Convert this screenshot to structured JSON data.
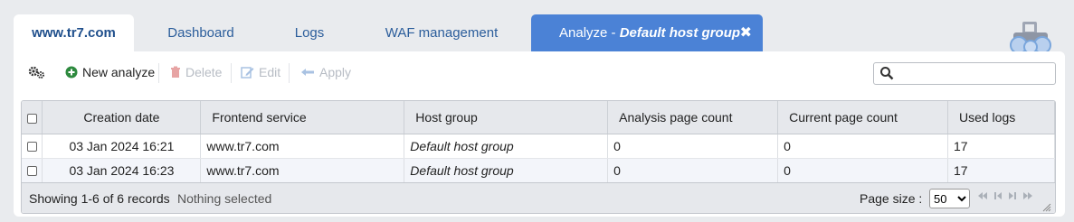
{
  "tabs": {
    "home": "www.tr7.com",
    "items": [
      "Dashboard",
      "Logs",
      "WAF management"
    ],
    "active_prefix": "Analyze - ",
    "active_em": "Default host group",
    "active_close": "✖"
  },
  "toolbar": {
    "new_analyze": "New analyze",
    "delete": "Delete",
    "edit": "Edit",
    "apply": "Apply"
  },
  "search": {
    "placeholder": "",
    "value": ""
  },
  "table": {
    "headers": [
      "Creation date",
      "Frontend service",
      "Host group",
      "Analysis page count",
      "Current page count",
      "Used logs"
    ],
    "rows": [
      [
        "03 Jan 2024 16:21",
        "www.tr7.com",
        "Default host group",
        "0",
        "0",
        "17"
      ],
      [
        "03 Jan 2024 16:23",
        "www.tr7.com",
        "Default host group",
        "0",
        "0",
        "17"
      ]
    ]
  },
  "footer": {
    "status": "Showing 1-6 of 6 records",
    "selection": "Nothing selected",
    "page_size_label": "Page size :",
    "page_size_value": "50"
  },
  "colors": {
    "active_tab": "#4b82d6",
    "tab_text": "#2b5d9b"
  },
  "icons": [
    "settings-icon",
    "plus-circle-icon",
    "trash-icon",
    "edit-icon",
    "undo-icon",
    "search-icon",
    "tractor-logo-icon",
    "close-icon",
    "first-page-icon",
    "prev-page-icon",
    "next-page-icon",
    "last-page-icon",
    "resize-grip-icon"
  ]
}
